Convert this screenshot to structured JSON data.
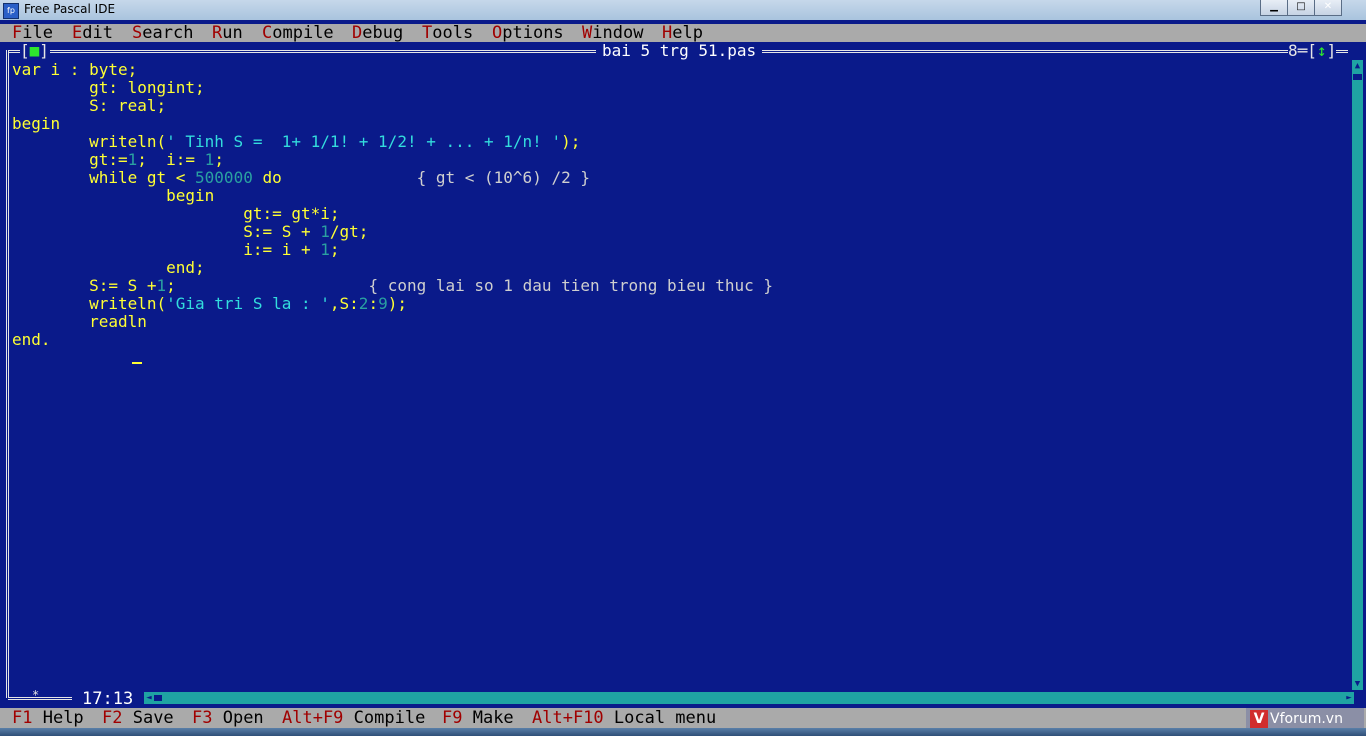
{
  "window": {
    "title": "Free Pascal IDE",
    "min": "▁",
    "max": "□",
    "close": "✕"
  },
  "menu": [
    {
      "hot": "F",
      "rest": "ile"
    },
    {
      "hot": "E",
      "rest": "dit"
    },
    {
      "hot": "S",
      "rest": "earch"
    },
    {
      "hot": "R",
      "rest": "un"
    },
    {
      "hot": "C",
      "rest": "ompile"
    },
    {
      "hot": "D",
      "rest": "ebug"
    },
    {
      "hot": "T",
      "rest": "ools"
    },
    {
      "hot": "O",
      "rest": "ptions"
    },
    {
      "hot": "W",
      "rest": "indow"
    },
    {
      "hot": "H",
      "rest": "elp"
    }
  ],
  "editor": {
    "file_name": "bai 5 trg 51.pas",
    "close_box_left": "[",
    "close_box_glyph": "■",
    "close_box_right": "]",
    "window_number": "8",
    "zoom_left": "[",
    "zoom_glyph": "↕",
    "zoom_right": "]",
    "cursor_position": "17:13",
    "modified_marker": "*"
  },
  "code": {
    "l1": [
      "var i : byte;"
    ],
    "l2": [
      "        gt: longint;"
    ],
    "l3": [
      "        S: real;"
    ],
    "l4": [
      "begin"
    ],
    "l5a": "        writeln(",
    "l5b": "' Tinh S =  1+ 1/1! + 1/2! + ... + 1/n! '",
    "l5c": ");",
    "l6a": "        gt:=",
    "l6b": "1",
    "l6c": ";  i:= ",
    "l6d": "1",
    "l6e": ";",
    "l7a": "        while gt < ",
    "l7b": "500000",
    "l7c": " do",
    "l7d": "              { gt < (10^6) /2 }",
    "l8": "                begin",
    "l9": "                        gt:= gt*i;",
    "l10a": "                        S:= S + ",
    "l10b": "1",
    "l10c": "/gt;",
    "l11a": "                        i:= i + ",
    "l11b": "1",
    "l11c": ";",
    "l12": "                end;",
    "l13a": "        S:= S +",
    "l13b": "1",
    "l13c": ";",
    "l13d": "                    { cong lai so 1 dau tien trong bieu thuc }",
    "l14a": "        writeln(",
    "l14b": "'Gia tri S la : '",
    "l14c": ",S:",
    "l14d": "2",
    "l14e": ":",
    "l14f": "9",
    "l14g": ");",
    "l15": "        readln",
    "l16": "end."
  },
  "keys": [
    {
      "key": "F1",
      "label": " Help"
    },
    {
      "key": "F2",
      "label": " Save"
    },
    {
      "key": "F3",
      "label": " Open"
    },
    {
      "key": "Alt+F9",
      "label": " Compile"
    },
    {
      "key": "F9",
      "label": " Make"
    },
    {
      "key": "Alt+F10",
      "label": " Local menu"
    }
  ],
  "watermark": {
    "mark": "V",
    "text": "Vforum.vn"
  },
  "colors": {
    "background": "#0a1a8a",
    "menu_bar": "#aaaaaa",
    "hotkey": "#a00000",
    "scrollbar": "#1fa3a3",
    "keyword_text": "#ffff33",
    "string_text": "#33dddd"
  }
}
